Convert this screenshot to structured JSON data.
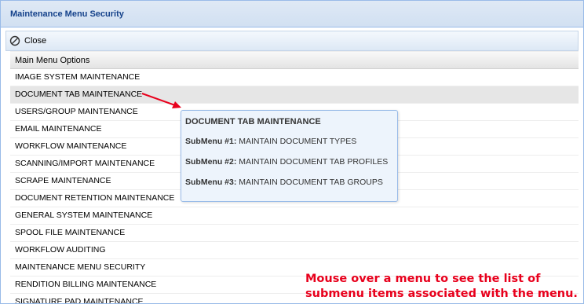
{
  "window": {
    "title": "Maintenance Menu Security"
  },
  "toolbar": {
    "close_label": "Close"
  },
  "grid": {
    "header": "Main Menu Options",
    "rows": [
      "IMAGE SYSTEM MAINTENANCE",
      "DOCUMENT TAB MAINTENANCE",
      "USERS/GROUP MAINTENANCE",
      "EMAIL MAINTENANCE",
      "WORKFLOW MAINTENANCE",
      "SCANNING/IMPORT MAINTENANCE",
      "SCRAPE MAINTENANCE",
      "DOCUMENT RETENTION MAINTENANCE",
      "GENERAL SYSTEM MAINTENANCE",
      "SPOOL FILE MAINTENANCE",
      "WORKFLOW AUDITING",
      "MAINTENANCE MENU SECURITY",
      "RENDITION BILLING MAINTENANCE",
      "SIGNATURE PAD MAINTENANCE"
    ]
  },
  "tooltip": {
    "title": "DOCUMENT TAB MAINTENANCE",
    "items": [
      {
        "label": "SubMenu #1:",
        "value": "MAINTAIN DOCUMENT TYPES"
      },
      {
        "label": "SubMenu #2:",
        "value": "MAINTAIN DOCUMENT TAB PROFILES"
      },
      {
        "label": "SubMenu #3:",
        "value": "MAINTAIN DOCUMENT TAB GROUPS"
      }
    ]
  },
  "annotation": {
    "line1": "Mouse over a menu to see the list of",
    "line2": "submenu items associated with the menu."
  },
  "colors": {
    "annotation": "#e8001c",
    "title": "#15428b",
    "hover_row": "#e6e6e6"
  },
  "icons": {
    "close": "circle-slash-icon"
  }
}
